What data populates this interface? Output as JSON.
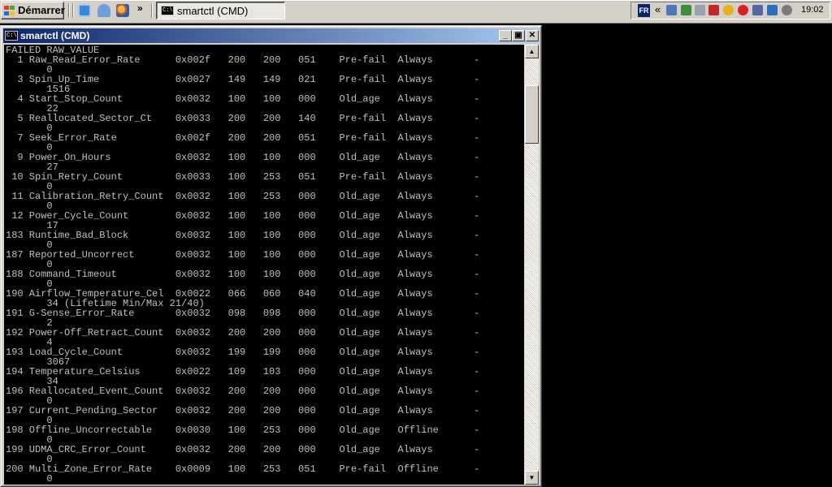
{
  "taskbar": {
    "start_label": "Démarrer",
    "quicklaunch": [
      "ie-icon",
      "desktop-icon",
      "firefox-icon"
    ],
    "overflow_glyph": "»",
    "task_label": "smartctl (CMD)",
    "language": "FR",
    "tray_overflow_glyph": "«",
    "clock": "19:02"
  },
  "window": {
    "title": "smartctl (CMD)",
    "icon_text": "C:\\",
    "controls": {
      "minimize": "_",
      "maximize": "▣",
      "close": "✕"
    }
  },
  "colors": {
    "title_start": "#0a246a",
    "title_end": "#a6caf0",
    "console_bg": "#000000",
    "console_fg": "#c0c0c0"
  },
  "console": {
    "lines": [
      "FAILED RAW_VALUE",
      "  1 Raw_Read_Error_Rate      0x002f   200   200   051    Pre-fail  Always       -",
      "       0",
      "  3 Spin_Up_Time             0x0027   149   149   021    Pre-fail  Always       -",
      "       1516",
      "  4 Start_Stop_Count         0x0032   100   100   000    Old_age   Always       -",
      "       22",
      "  5 Reallocated_Sector_Ct    0x0033   200   200   140    Pre-fail  Always       -",
      "       0",
      "  7 Seek_Error_Rate          0x002f   200   200   051    Pre-fail  Always       -",
      "       0",
      "  9 Power_On_Hours           0x0032   100   100   000    Old_age   Always       -",
      "       27",
      " 10 Spin_Retry_Count         0x0033   100   253   051    Pre-fail  Always       -",
      "       0",
      " 11 Calibration_Retry_Count  0x0032   100   253   000    Old_age   Always       -",
      "       0",
      " 12 Power_Cycle_Count        0x0032   100   100   000    Old_age   Always       -",
      "       17",
      "183 Runtime_Bad_Block        0x0032   100   100   000    Old_age   Always       -",
      "       0",
      "187 Reported_Uncorrect       0x0032   100   100   000    Old_age   Always       -",
      "       0",
      "188 Command_Timeout          0x0032   100   100   000    Old_age   Always       -",
      "       0",
      "190 Airflow_Temperature_Cel  0x0022   066   060   040    Old_age   Always       -",
      "       34 (Lifetime Min/Max 21/40)",
      "191 G-Sense_Error_Rate       0x0032   098   098   000    Old_age   Always       -",
      "       2",
      "192 Power-Off_Retract_Count  0x0032   200   200   000    Old_age   Always       -",
      "       4",
      "193 Load_Cycle_Count         0x0032   199   199   000    Old_age   Always       -",
      "       3067",
      "194 Temperature_Celsius      0x0022   109   103   000    Old_age   Always       -",
      "       34",
      "196 Reallocated_Event_Count  0x0032   200   200   000    Old_age   Always       -",
      "       0",
      "197 Current_Pending_Sector   0x0032   200   200   000    Old_age   Always       -",
      "       0",
      "198 Offline_Uncorrectable    0x0030   100   253   000    Old_age   Offline      -",
      "       0",
      "199 UDMA_CRC_Error_Count     0x0032   200   200   000    Old_age   Always       -",
      "       0",
      "200 Multi_Zone_Error_Rate    0x0009   100   253   051    Pre-fail  Offline      -",
      "       0"
    ]
  },
  "scrollbar": {
    "up_glyph": "▲",
    "down_glyph": "▼"
  }
}
